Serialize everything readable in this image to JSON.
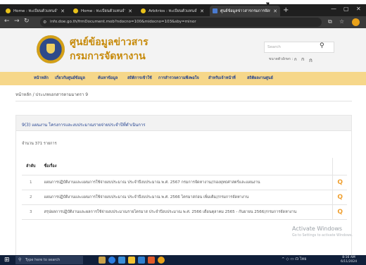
{
  "top_glyph": "ู",
  "browser": {
    "tabs": [
      {
        "label": "Home : ทะเบียนตัวแทนจำหน่าย"
      },
      {
        "label": "Home : ทะเบียนตัวแทนจำหน่าย"
      },
      {
        "label": "Arbitrios : ทะเบียนตัวแทนจำหน่าย"
      },
      {
        "label": "ศูนย์ข้อมูลข่าวสารกรมการจัดหางาน"
      }
    ],
    "url": "info.doe.go.th/frmDocument.mob?ndocno=100&midocno=103&sby=minor"
  },
  "site": {
    "title_line1": "ศูนย์ข้อมูลข่าวสาร",
    "title_line2": "กรมการจัดหางาน",
    "search_placeholder": "Search",
    "fontsize_label": "ขนาดตัวอักษร :",
    "fontsize_buttons": [
      "ก",
      "ก",
      "ก"
    ]
  },
  "menu": [
    "หน้าหลัก",
    "เกี่ยวกับศูนย์ข้อมูล",
    "ค้นหาข้อมูล",
    "สถิติการเข้าใช้",
    "การสำรวจความพึงพอใจ",
    "สำหรับเจ้าหน้าที่",
    "สถิติผลงานศูนย์"
  ],
  "breadcrumb": "หน้าหลัก / ประเภทเอกสารตามมาตรา 9",
  "panel": {
    "title": "9(3) แผนงาน โครงการและงบประมาณรายจ่ายประจำปีที่ดำเนินการ",
    "count": "จำนวน 371 รายการ",
    "columns": [
      "ลำดับ",
      "ชื่อเรื่อง"
    ],
    "rows": [
      {
        "no": "1",
        "title": "แผนการปฏิบัติงานและแผนการใช้จ่ายงบประมาณ ประจำปีงบประมาณ พ.ศ. 2567 กรมการจัดหางาน//กองยุทธศาสตร์และแผนงาน"
      },
      {
        "no": "2",
        "title": "แผนการปฏิบัติงานและแผนการใช้จ่ายงบประมาณ ประจำปีงบประมาณ พ.ศ. 2566 ไตรมาสก่อน เพิ่มเติม//กรมการจัดหางาน"
      },
      {
        "no": "3",
        "title": "สรุปผลการปฏิบัติงานและผลการใช้จ่ายงบประมาณรายไตรมาส ประจำปีงบประมาณ พ.ศ. 2566 เดือนตุลาคม 2565 - กันยายน 2566//กรมการจัดหางาน"
      }
    ]
  },
  "watermark": {
    "line1": "Activate Windows",
    "line2": "Go to Settings to activate Windows."
  },
  "taskbar": {
    "search_placeholder": "Type here to search",
    "tray": "^ ◇ ▭ ☊ ไทย",
    "time": "8:16 AM",
    "date": "6/11/2024"
  }
}
